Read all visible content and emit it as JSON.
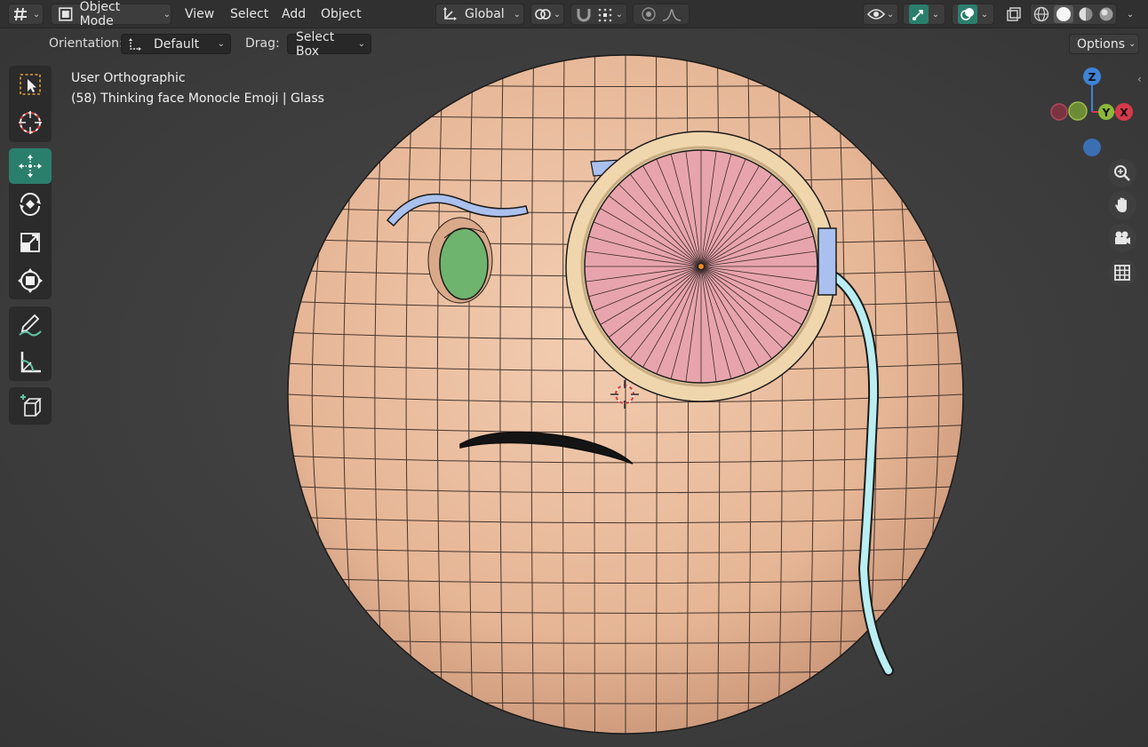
{
  "header": {
    "editor_type_icon": "grid-editor-icon",
    "mode_label": "Object Mode",
    "menus": [
      "View",
      "Select",
      "Add",
      "Object"
    ],
    "transform_orientation": "Global",
    "options_label": "Options"
  },
  "tool_settings": {
    "orientation_label": "Orientation:",
    "orientation_value": "Default",
    "drag_label": "Drag:",
    "drag_value": "Select Box"
  },
  "viewport": {
    "view_name": "User Orthographic",
    "object_info": "(58) Thinking face Monocle Emoji | Glass"
  },
  "gizmo": {
    "z_label": "Z",
    "y_label": "Y",
    "x_label": "X"
  },
  "colors": {
    "accent": "#2a7f6c",
    "skin": "#e7b898",
    "lens": "#e8a4ac",
    "rim": "#efd6ad",
    "eye": "#6fb46e",
    "brow": "#aac0ee",
    "cord": "#b9eef2",
    "axis_x": "#d6394c",
    "axis_y": "#8cb83a",
    "axis_z": "#3e84d6"
  },
  "toolbar_icons": [
    "select-box-icon",
    "cursor-icon",
    "move-icon",
    "rotate-icon",
    "scale-icon",
    "transform-icon",
    "annotate-icon",
    "measure-icon",
    "add-cube-icon"
  ],
  "nav_icons": [
    "zoom-icon",
    "hand-pan-icon",
    "camera-icon",
    "grid-view-icon"
  ]
}
